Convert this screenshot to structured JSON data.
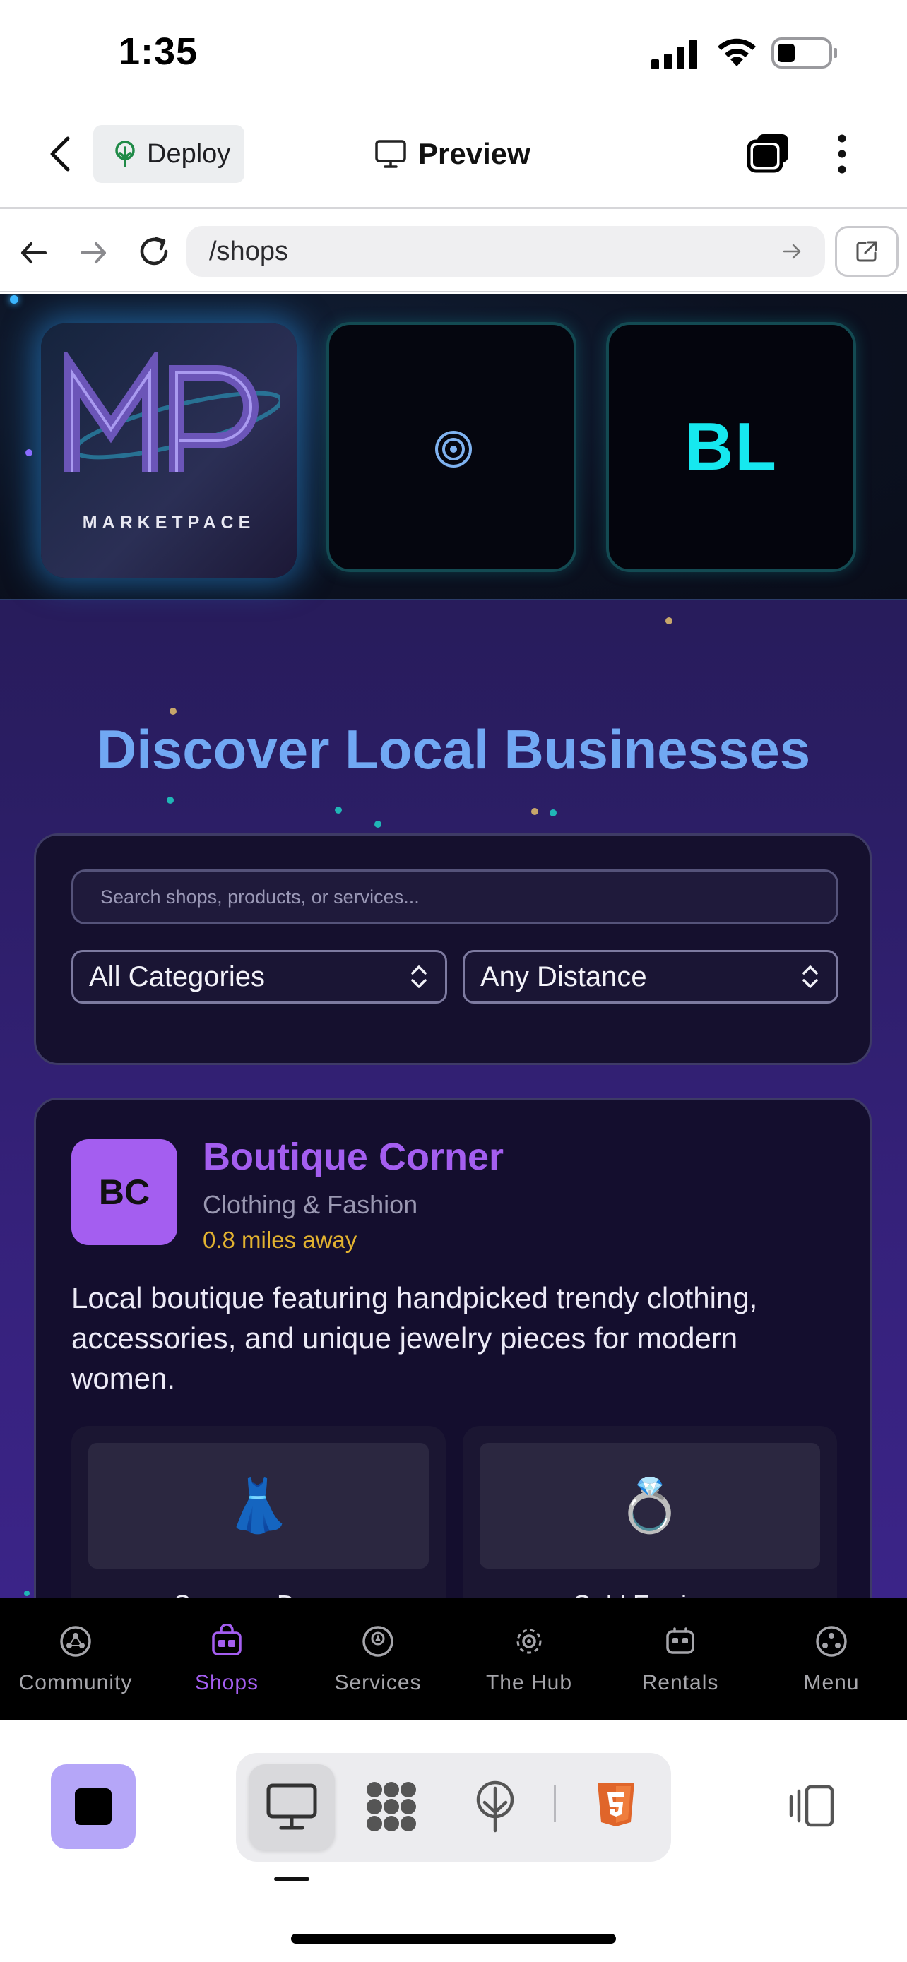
{
  "status_bar": {
    "time": "1:35"
  },
  "header": {
    "deploy_label": "Deploy",
    "preview_label": "Preview"
  },
  "browser": {
    "url": "/shops"
  },
  "logos": {
    "tile1_wordmark": "MARKETPACE",
    "tile3_text": "BL"
  },
  "page": {
    "headline": "Discover Local Businesses",
    "search_placeholder": "Search shops, products, or services...",
    "category_select": "All Categories",
    "distance_select": "Any Distance"
  },
  "shop": {
    "initials": "BC",
    "name": "Boutique Corner",
    "category": "Clothing & Fashion",
    "distance": "0.8 miles away",
    "description": "Local boutique featuring handpicked trendy clothing, accessories, and unique jewelry pieces for modern women.",
    "products": [
      {
        "emoji": "👗",
        "name": "Summer Dress"
      },
      {
        "emoji": "💍",
        "name": "Gold Earrings"
      }
    ]
  },
  "bottom_nav": [
    {
      "label": "Community",
      "icon": "community-icon"
    },
    {
      "label": "Shops",
      "icon": "shops-icon",
      "active": true
    },
    {
      "label": "Services",
      "icon": "services-icon"
    },
    {
      "label": "The Hub",
      "icon": "hub-icon"
    },
    {
      "label": "Rentals",
      "icon": "rentals-icon"
    },
    {
      "label": "Menu",
      "icon": "menu-icon"
    }
  ],
  "colors": {
    "accent_purple": "#a45ef0",
    "headline_blue": "#71a8f3",
    "distance_yellow": "#e2b230",
    "bl_cyan": "#16e8ef",
    "stop_button": "#b5a6f8",
    "html5_orange": "#e0652a"
  }
}
